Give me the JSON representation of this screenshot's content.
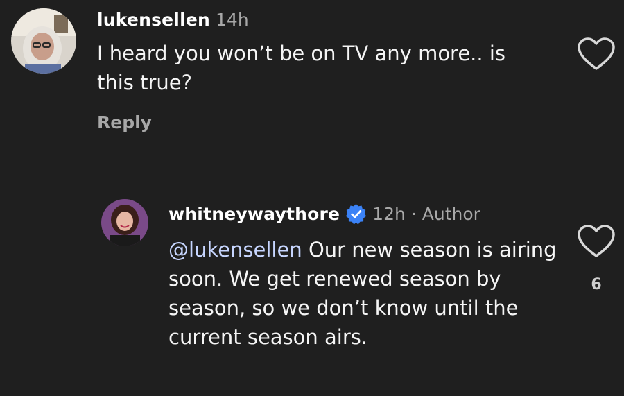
{
  "comments": [
    {
      "username": "lukensellen",
      "time": "14h",
      "text": "I heard you won’t be on TV any more.. is this true?",
      "reply_label": "Reply",
      "avatar_icon": "user-avatar-photo"
    },
    {
      "username": "whitneywaythore",
      "time": "12h",
      "separator": "·",
      "author_label": "Author",
      "mention": "@lukensellen",
      "text": "Our new season is airing soon. We get renewed season by season, so we don’t know until the current season airs.",
      "likes": "6",
      "avatar_icon": "user-avatar-photo"
    }
  ],
  "colors": {
    "background": "#1f1f1f",
    "text": "#f5f5f5",
    "secondary": "#a8a8a8",
    "mention": "#c7d6ff",
    "verified": "#3b82f6"
  }
}
